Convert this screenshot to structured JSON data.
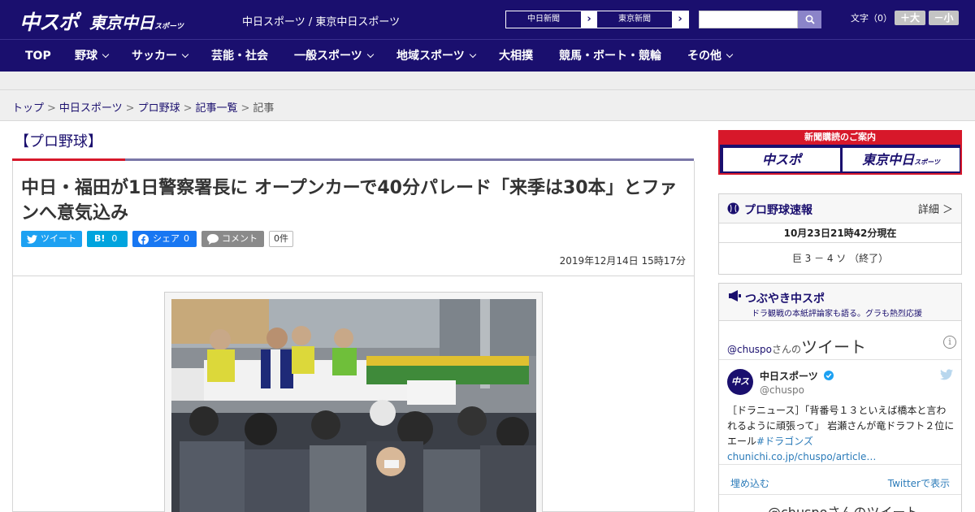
{
  "header": {
    "logo_chuspo": "中スポ",
    "logo_tokyo": "東京中日",
    "logo_tokyo_sub": "スポーツ",
    "site_title": "中日スポーツ / 東京中日スポーツ",
    "paper_links": [
      "中日新聞",
      "東京新聞"
    ],
    "search_placeholder": "",
    "font_size_label": "文字（0）",
    "font_plus": "＋大",
    "font_minus": "－小"
  },
  "nav": {
    "items": [
      "TOP",
      "野球",
      "サッカー",
      "芸能・社会",
      "一般スポーツ",
      "地域スポーツ",
      "大相撲",
      "競馬・ボート・競輪",
      "その他"
    ]
  },
  "breadcrumb": {
    "items": [
      "トップ",
      "中日スポーツ",
      "プロ野球",
      "記事一覧",
      "記事"
    ],
    "sep": ">"
  },
  "article": {
    "category": "【プロ野球】",
    "headline": "中日・福田が1日警察署長に オープンカーで40分パレード「来季は30本」とファンへ意気込み",
    "share": {
      "tweet": "ツイート",
      "hatena": "B!",
      "hatena_count": "0",
      "fb": "シェア",
      "fb_count": "0",
      "comment": "コメント",
      "comment_count": "0件"
    },
    "date": "2019年12月14日 15時17分"
  },
  "sidebar": {
    "ad": {
      "title": "新聞購読のご案内",
      "btn1": "中スポ",
      "btn2": "東京中日",
      "btn2_sub": "スポーツ"
    },
    "baseball": {
      "title": "プロ野球速報",
      "detail": "詳細 ＞",
      "timestamp": "10月23日21時42分現在",
      "score": "巨 3 － 4 ソ （終了）"
    },
    "twitter": {
      "title": "つぶやき中スポ",
      "subtitle": "ドラ観戦の本紙評論家も語る。グラも熱烈応援",
      "handle": "@chuspo",
      "handle_suffix": "さんの",
      "handle_big": "ツイート",
      "avatar_text": "中スポ",
      "name": "中日スポーツ",
      "user": "@chuspo",
      "text_main": "［ドラニュース］「背番号１３といえば橋本と言われるように頑張って」 岩瀬さんが竜ドラフト２位にエール",
      "text_link": "#ドラゴンズchunichi.co.jp/chuspo/article…",
      "embed": "埋め込む",
      "view_on": "Twitterで表示",
      "bottom_text": "@chuspoさんのツイート"
    }
  },
  "colors": {
    "brand": "#1a0f6e",
    "accent_red": "#d7182a",
    "twitter": "#1da1f2",
    "hatena": "#00a4de",
    "facebook": "#1877f2",
    "comment": "#8a8a8a"
  }
}
